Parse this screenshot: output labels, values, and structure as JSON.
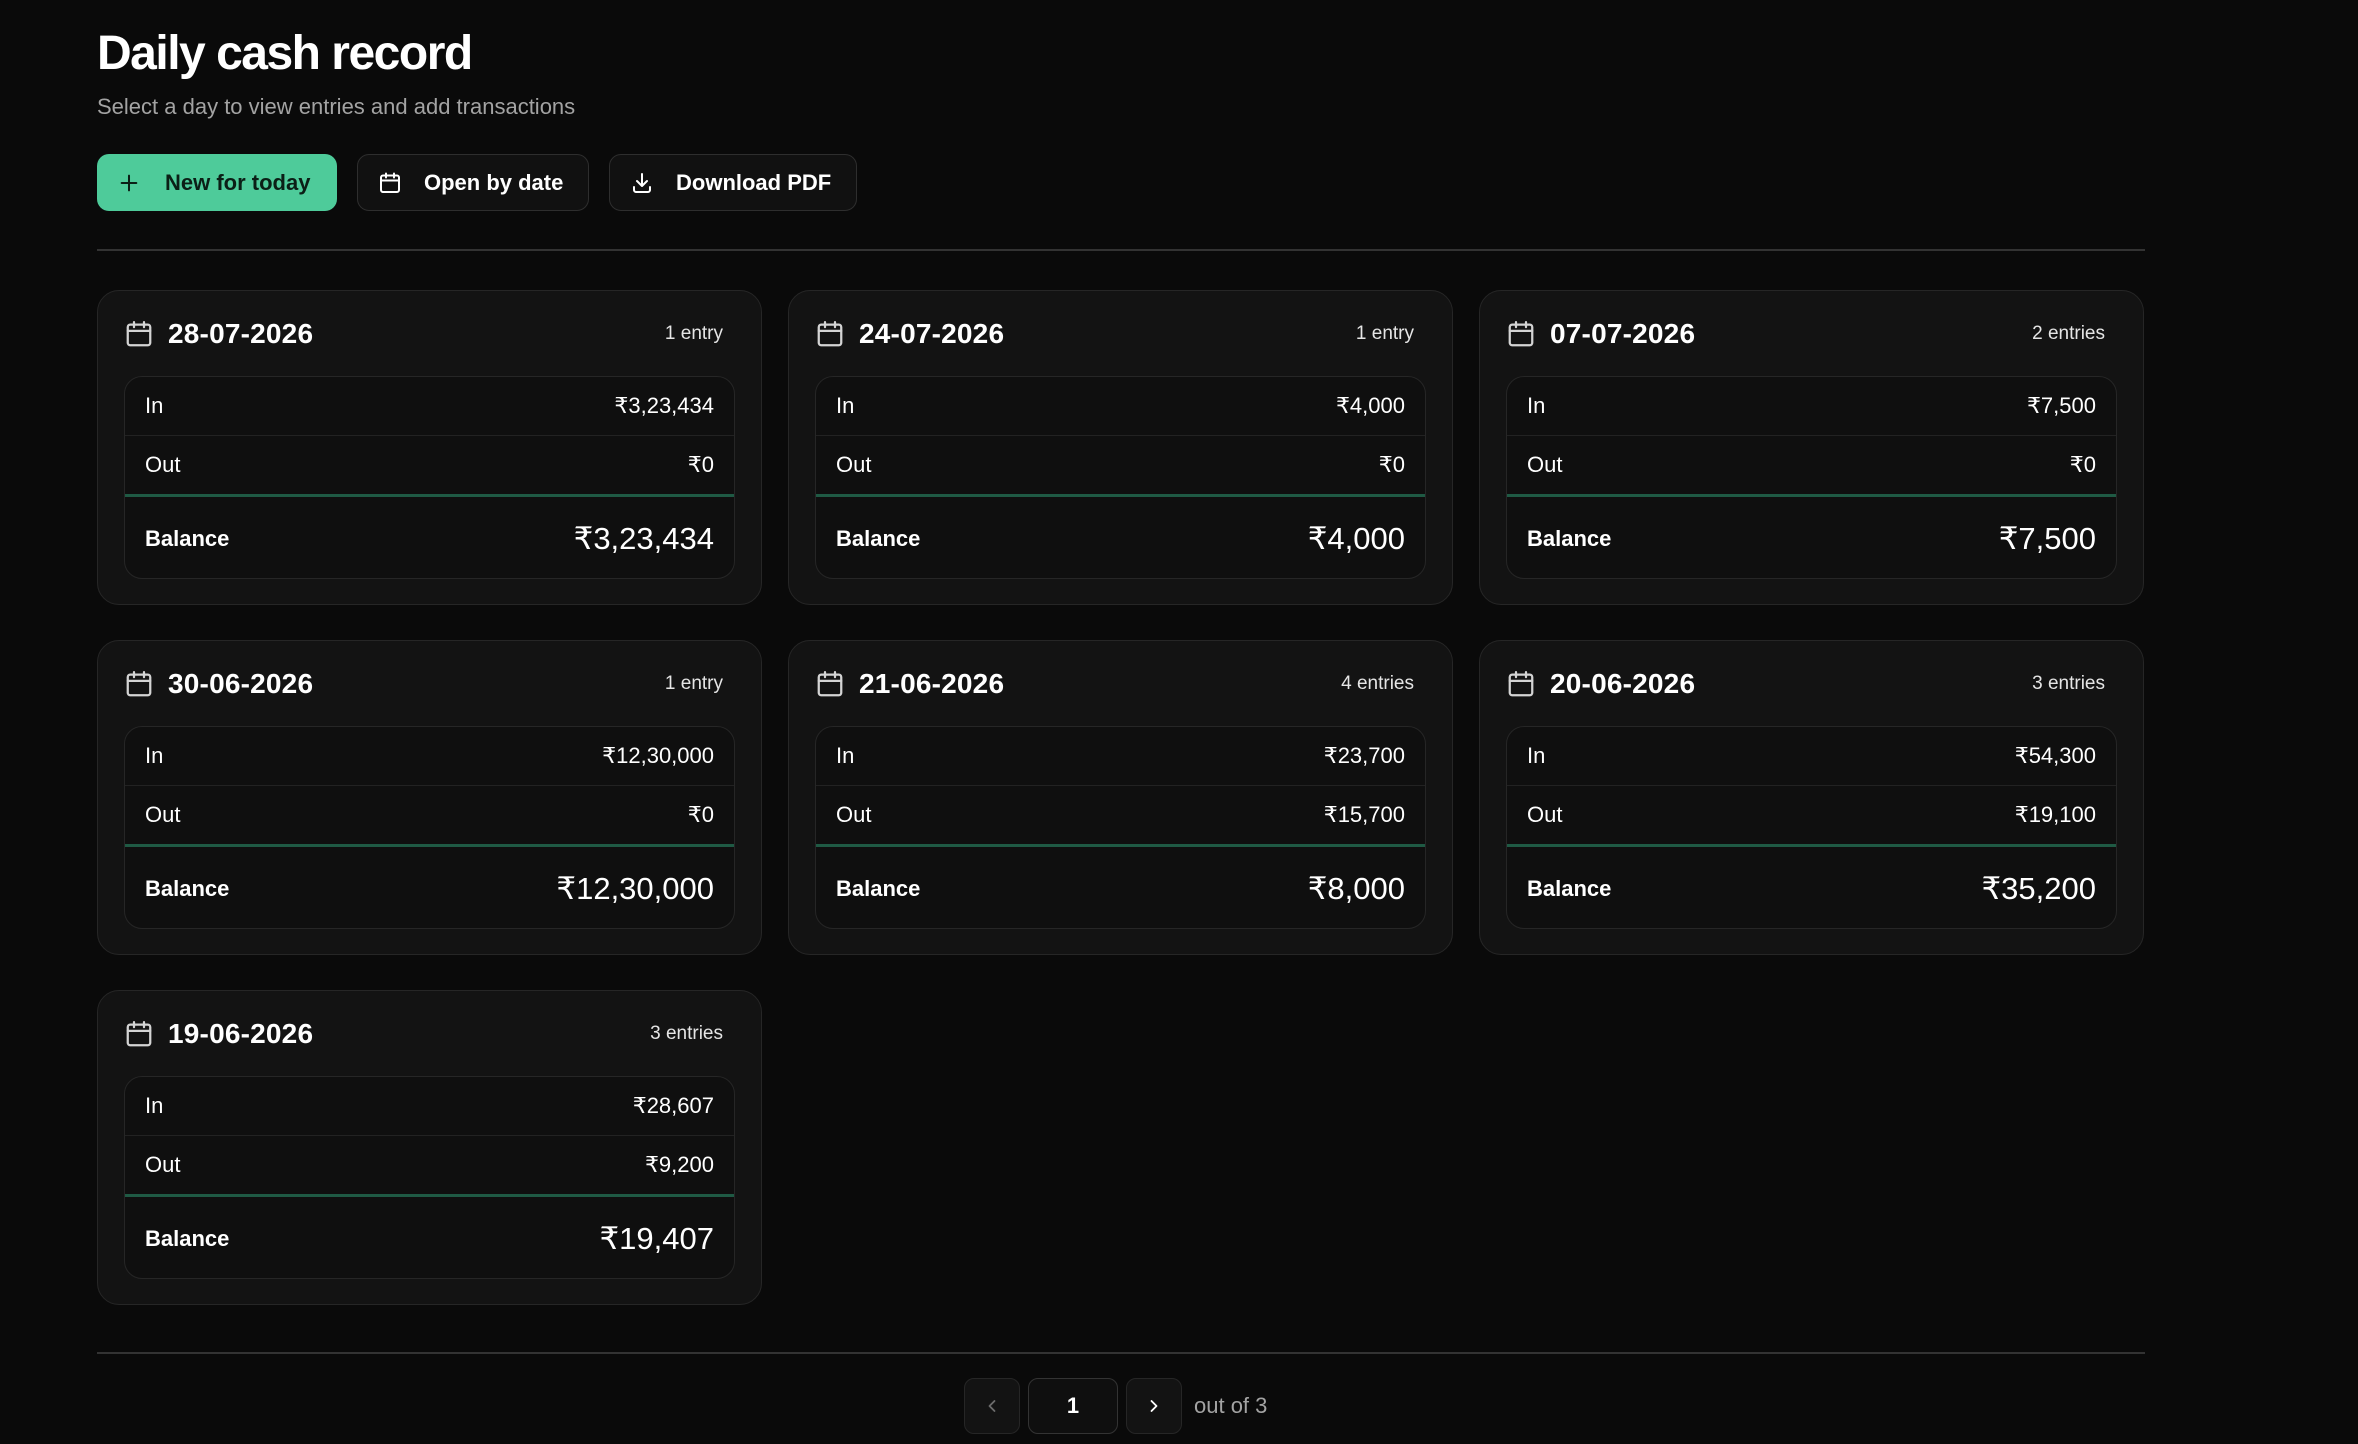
{
  "header": {
    "title": "Daily cash record",
    "subtitle": "Select a day to view entries and add transactions"
  },
  "toolbar": {
    "new_label": "New for today",
    "open_label": "Open by date",
    "download_label": "Download PDF"
  },
  "labels": {
    "in": "In",
    "out": "Out",
    "balance": "Balance"
  },
  "days": [
    {
      "date": "28-07-2026",
      "count": "1 entry",
      "in": "₹3,23,434",
      "out": "₹0",
      "balance": "₹3,23,434"
    },
    {
      "date": "24-07-2026",
      "count": "1 entry",
      "in": "₹4,000",
      "out": "₹0",
      "balance": "₹4,000"
    },
    {
      "date": "07-07-2026",
      "count": "2 entries",
      "in": "₹7,500",
      "out": "₹0",
      "balance": "₹7,500"
    },
    {
      "date": "30-06-2026",
      "count": "1 entry",
      "in": "₹12,30,000",
      "out": "₹0",
      "balance": "₹12,30,000"
    },
    {
      "date": "21-06-2026",
      "count": "4 entries",
      "in": "₹23,700",
      "out": "₹15,700",
      "balance": "₹8,000"
    },
    {
      "date": "20-06-2026",
      "count": "3 entries",
      "in": "₹54,300",
      "out": "₹19,100",
      "balance": "₹35,200"
    },
    {
      "date": "19-06-2026",
      "count": "3 entries",
      "in": "₹28,607",
      "out": "₹9,200",
      "balance": "₹19,407"
    }
  ],
  "pagination": {
    "current": "1",
    "total_text": "out of 3"
  },
  "colors": {
    "accent": "#4ecb9a",
    "background": "#0a0a0a",
    "card": "#131313",
    "balance_line": "#1f5a44"
  },
  "icons": {
    "new": "plus-icon",
    "open": "calendar-icon",
    "download": "download-icon",
    "card": "calendar-icon",
    "prev": "chevron-left-icon",
    "next": "chevron-right-icon"
  }
}
